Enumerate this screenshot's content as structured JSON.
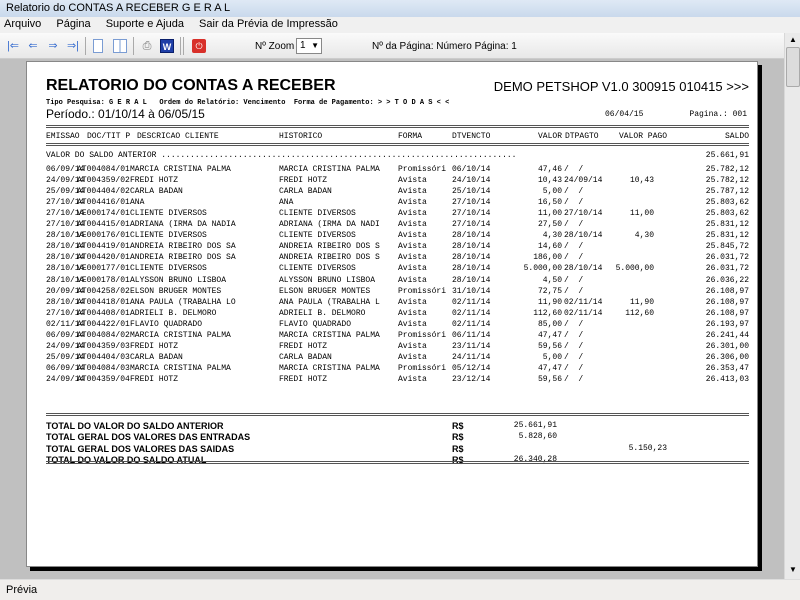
{
  "window": {
    "title": "Relatorio do CONTAS A RECEBER G E R A L"
  },
  "menu": [
    "Arquivo",
    "Página",
    "Suporte e Ajuda",
    "Sair da Prévia de Impressão"
  ],
  "toolbar": {
    "zoom_label": "Nº Zoom",
    "zoom_value": "1",
    "page_label": "Nº da Página: Número Página: 1"
  },
  "status": "Prévia",
  "report": {
    "title": "RELATORIO DO CONTAS A RECEBER",
    "company": "DEMO PETSHOP V1.0 300915 010415 >>>",
    "filters": "Tipo Pesquisa: G E R A L   Ordem do Relatório: Vencimento  Forma de Pagamento: > > T O D A S < <",
    "period": "Período.: 01/10/14 à 06/05/15",
    "date": "06/04/15",
    "page": "Pagina.: 001",
    "columns": {
      "emissao": "EMISSAO",
      "doc": "DOC/TIT P",
      "descricao": "DESCRICAO CLIENTE",
      "historico": "HISTORICO",
      "forma": "FORMA",
      "dtvencto": "DTVENCTO",
      "valor": "VALOR",
      "dtpagto": "DTPAGTO",
      "valor_pago": "VALOR PAGO",
      "saldo": "SALDO"
    },
    "saldo_anterior_label": "VALOR DO SALDO ANTERIOR ..........................................................................",
    "saldo_anterior": "25.661,91",
    "rows": [
      [
        "06/09/14",
        "AT004084/01",
        "MARCIA CRISTINA PALMA",
        "MARCIA CRISTINA PALMA",
        "Promissóri",
        "06/10/14",
        "47,46",
        "/  /",
        "",
        "25.782,12"
      ],
      [
        "24/09/14",
        "AT004359/02",
        "FREDI HOTZ",
        "FREDI HOTZ",
        "Avista",
        "24/10/14",
        "10,43",
        "24/09/14",
        "10,43",
        "25.782,12"
      ],
      [
        "25/09/14",
        "AT004404/02",
        "CARLA BADAN",
        "CARLA BADAN",
        "Avista",
        "25/10/14",
        "5,00",
        "/  /",
        "",
        "25.787,12"
      ],
      [
        "27/10/14",
        "AT004416/01",
        "ANA",
        "ANA",
        "Avista",
        "27/10/14",
        "16,50",
        "/  /",
        "",
        "25.803,62"
      ],
      [
        "27/10/14",
        "VE000174/01",
        "CLIENTE DIVERSOS",
        "CLIENTE DIVERSOS",
        "Avista",
        "27/10/14",
        "11,00",
        "27/10/14",
        "11,00",
        "25.803,62"
      ],
      [
        "27/10/14",
        "AT004415/01",
        "ADRIANA (IRMA DA NADIA",
        "ADRIANA (IRMA DA NADI",
        "Avista",
        "27/10/14",
        "27,50",
        "/  /",
        "",
        "25.831,12"
      ],
      [
        "28/10/14",
        "VE000176/01",
        "CLIENTE DIVERSOS",
        "CLIENTE DIVERSOS",
        "Avista",
        "28/10/14",
        "4,30",
        "28/10/14",
        "4,30",
        "25.831,12"
      ],
      [
        "28/10/14",
        "AT004419/01",
        "ANDREIA RIBEIRO DOS SA",
        "ANDREIA RIBEIRO DOS S",
        "Avista",
        "28/10/14",
        "14,60",
        "/  /",
        "",
        "25.845,72"
      ],
      [
        "28/10/14",
        "AT004420/01",
        "ANDREIA RIBEIRO DOS SA",
        "ANDREIA RIBEIRO DOS S",
        "Avista",
        "28/10/14",
        "186,00",
        "/  /",
        "",
        "26.031,72"
      ],
      [
        "28/10/14",
        "VE000177/01",
        "CLIENTE DIVERSOS",
        "CLIENTE DIVERSOS",
        "Avista",
        "28/10/14",
        "5.000,00",
        "28/10/14",
        "5.000,00",
        "26.031,72"
      ],
      [
        "28/10/14",
        "VE000178/01",
        "ALYSSON BRUNO LISBOA",
        "ALYSSON BRUNO LISBOA",
        "Avista",
        "28/10/14",
        "4,50",
        "/  /",
        "",
        "26.036,22"
      ],
      [
        "20/09/14",
        "AT004258/02",
        "ELSON BRUGER MONTES",
        "ELSON BRUGER MONTES",
        "Promissóri",
        "31/10/14",
        "72,75",
        "/  /",
        "",
        "26.108,97"
      ],
      [
        "28/10/14",
        "AT004418/01",
        "ANA PAULA (TRABALHA LO",
        "ANA PAULA (TRABALHA L",
        "Avista",
        "02/11/14",
        "11,90",
        "02/11/14",
        "11,90",
        "26.108,97"
      ],
      [
        "27/10/14",
        "AT004408/01",
        "ADRIELI B. DELMORO",
        "ADRIELI B. DELMORO",
        "Avista",
        "02/11/14",
        "112,60",
        "02/11/14",
        "112,60",
        "26.108,97"
      ],
      [
        "02/11/14",
        "AT004422/01",
        "FLAVIO QUADRADO",
        "FLAVIO QUADRADO",
        "Avista",
        "02/11/14",
        "85,00",
        "/  /",
        "",
        "26.193,97"
      ],
      [
        "06/09/14",
        "AT004084/02",
        "MARCIA CRISTINA PALMA",
        "MARCIA CRISTINA PALMA",
        "Promissóri",
        "06/11/14",
        "47,47",
        "/  /",
        "",
        "26.241,44"
      ],
      [
        "24/09/14",
        "AT004359/03",
        "FREDI HOTZ",
        "FREDI HOTZ",
        "Avista",
        "23/11/14",
        "59,56",
        "/  /",
        "",
        "26.301,00"
      ],
      [
        "25/09/14",
        "AT004404/03",
        "CARLA BADAN",
        "CARLA BADAN",
        "Avista",
        "24/11/14",
        "5,00",
        "/  /",
        "",
        "26.306,00"
      ],
      [
        "06/09/14",
        "AT004084/03",
        "MARCIA CRISTINA PALMA",
        "MARCIA CRISTINA PALMA",
        "Promissóri",
        "05/12/14",
        "47,47",
        "/  /",
        "",
        "26.353,47"
      ],
      [
        "24/09/14",
        "AT004359/04",
        "FREDI HOTZ",
        "FREDI HOTZ",
        "Avista",
        "23/12/14",
        "59,56",
        "/  /",
        "",
        "26.413,03"
      ]
    ],
    "totals": [
      {
        "label": "TOTAL DO VALOR DO SALDO ANTERIOR",
        "currency": "R$",
        "entrada": "25.661,91",
        "saida": ""
      },
      {
        "label": "TOTAL GERAL DOS VALORES DAS ENTRADAS",
        "currency": "R$",
        "entrada": "5.828,60",
        "saida": ""
      },
      {
        "label": "TOTAL GERAL DOS VALORES DAS SAIDAS",
        "currency": "R$",
        "entrada": "",
        "saida": "5.150,23"
      },
      {
        "label": "TOTAL DO VALOR DO SALDO ATUAL",
        "currency": "R$",
        "entrada": "26.340,28",
        "saida": ""
      }
    ]
  }
}
